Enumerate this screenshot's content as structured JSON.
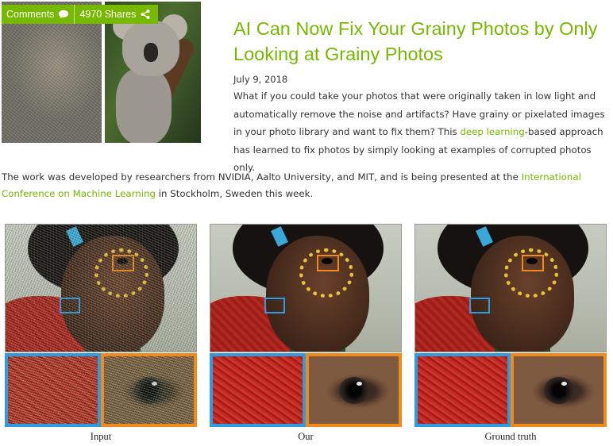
{
  "header": {
    "comments_label": "Comments",
    "shares_label": "4970 Shares",
    "comments_icon": "speech-bubble-icon",
    "shares_icon": "share-icon"
  },
  "article": {
    "title": "AI Can Now Fix Your Grainy Photos by Only Looking at Grainy Photos",
    "date": "July 9, 2018",
    "intro_before_link": "What if you could take your photos that were originally taken in low light and automatically remove the noise and artifacts? Have grainy or pixelated images in your photo library and want to fix them? This ",
    "intro_link": "deep learning",
    "intro_after_link": "-based approach has learned to fix photos by simply looking at examples of corrupted photos only.",
    "body_before_link": "The work was developed by researchers from NVIDIA, Aalto University, and MIT, and is being presented at the ",
    "body_link": "International Conference on Machine Learning",
    "body_after_link": " in Stockholm, Sweden this week."
  },
  "figure": {
    "captions": [
      "Input",
      "Our",
      "Ground truth"
    ]
  },
  "colors": {
    "accent": "#76b900",
    "blue_box": "#2f9be0",
    "orange_box": "#f08a1a"
  }
}
